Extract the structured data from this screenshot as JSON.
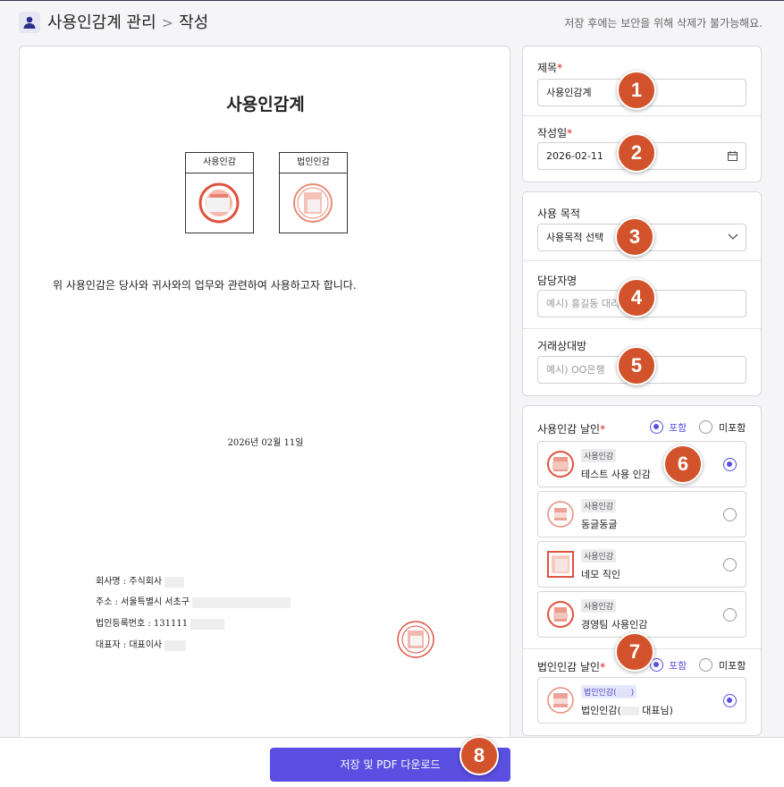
{
  "header": {
    "title": "사용인감계 관리",
    "separator": ">",
    "subtitle": "작성",
    "notice": "저장 후에는 보안을 위해 삭제가 불가능해요."
  },
  "document": {
    "title": "사용인감계",
    "seal_box_1": "사용인감",
    "seal_box_2": "법인인감",
    "purpose_text": "위 사용인감은 당사와 귀사와의 업무와 관련하여 사용하고자 합니다.",
    "date": "2026년 02월 11일",
    "company": "회사명 : 주식회사",
    "address": "주소 : 서울특별시 서초구",
    "reg_no": "법인등록번호 : 131111",
    "ceo": "대표자 : 대표이사"
  },
  "form": {
    "title_label": "제목",
    "title_value": "사용인감계",
    "date_label": "작성일",
    "date_value": "2026-02-11",
    "purpose_label": "사용 목적",
    "purpose_value": "사용목적 선택",
    "manager_label": "담당자명",
    "manager_placeholder": "예시) 홍길동 대리",
    "counterparty_label": "거래상대방",
    "counterparty_placeholder": "예시) OO은행",
    "required_mark": "*"
  },
  "seal_section": {
    "label": "사용인감 날인",
    "include": "포함",
    "exclude": "미포함",
    "include_selected": true,
    "items": [
      {
        "tag": "사용인감",
        "name": "테스트 사용 인감",
        "selected": true
      },
      {
        "tag": "사용인감",
        "name": "동글동글",
        "selected": false
      },
      {
        "tag": "사용인감",
        "name": "네모 직인",
        "selected": false
      },
      {
        "tag": "사용인감",
        "name": "경영팀 사용인감",
        "selected": false
      }
    ]
  },
  "corp_section": {
    "label": "법인인감 날인",
    "include": "포함",
    "exclude": "미포함",
    "include_selected": true,
    "items": [
      {
        "tag": "법인인감(",
        "tag_end": ")",
        "name": "법인인감(",
        "name_end": "대표님)",
        "selected": true
      }
    ]
  },
  "footer": {
    "save_label": "저장 및 PDF 다운로드"
  },
  "badges": [
    "1",
    "2",
    "3",
    "4",
    "5",
    "6",
    "7",
    "8"
  ],
  "colors": {
    "accent": "#5a4fe0",
    "badge": "#d2532b",
    "seal": "#e0533f",
    "required": "#e02020"
  },
  "icons": {
    "user": "user-icon",
    "calendar": "calendar-icon",
    "chevron": "chevron-down-icon"
  }
}
